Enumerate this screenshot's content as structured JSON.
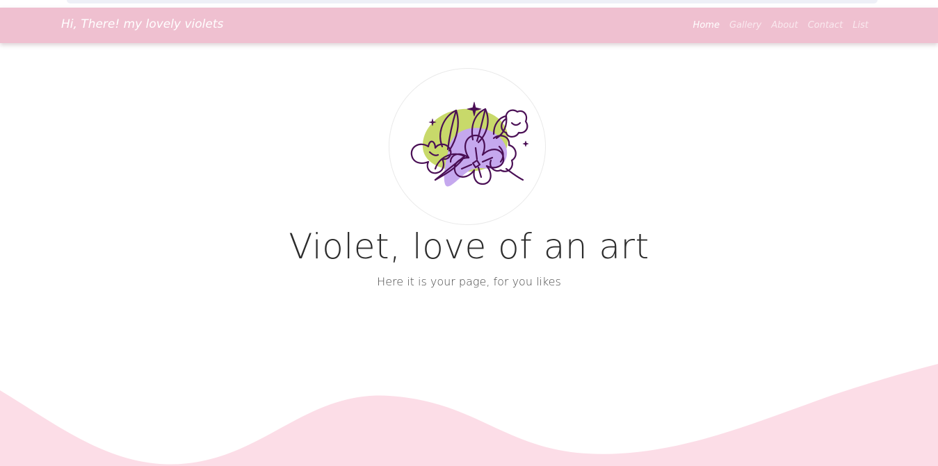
{
  "navbar": {
    "brand": "Hi, There! my lovely violets",
    "links": [
      {
        "label": "Home",
        "active": true
      },
      {
        "label": "Gallery",
        "active": false
      },
      {
        "label": "About",
        "active": false
      },
      {
        "label": "Contact",
        "active": false
      },
      {
        "label": "List",
        "active": false
      }
    ]
  },
  "hero": {
    "logo_icon": "violet-flower-logo-icon",
    "title": "Violet, love of an art",
    "subtitle": "Here it is your page, for you likes"
  },
  "colors": {
    "navbar_bg": "#efc0d0",
    "wave_bg": "#fcdde7",
    "flower_purple": "#c5a8ee",
    "leaf_green": "#c8d96a",
    "outline": "#4a0f55"
  }
}
